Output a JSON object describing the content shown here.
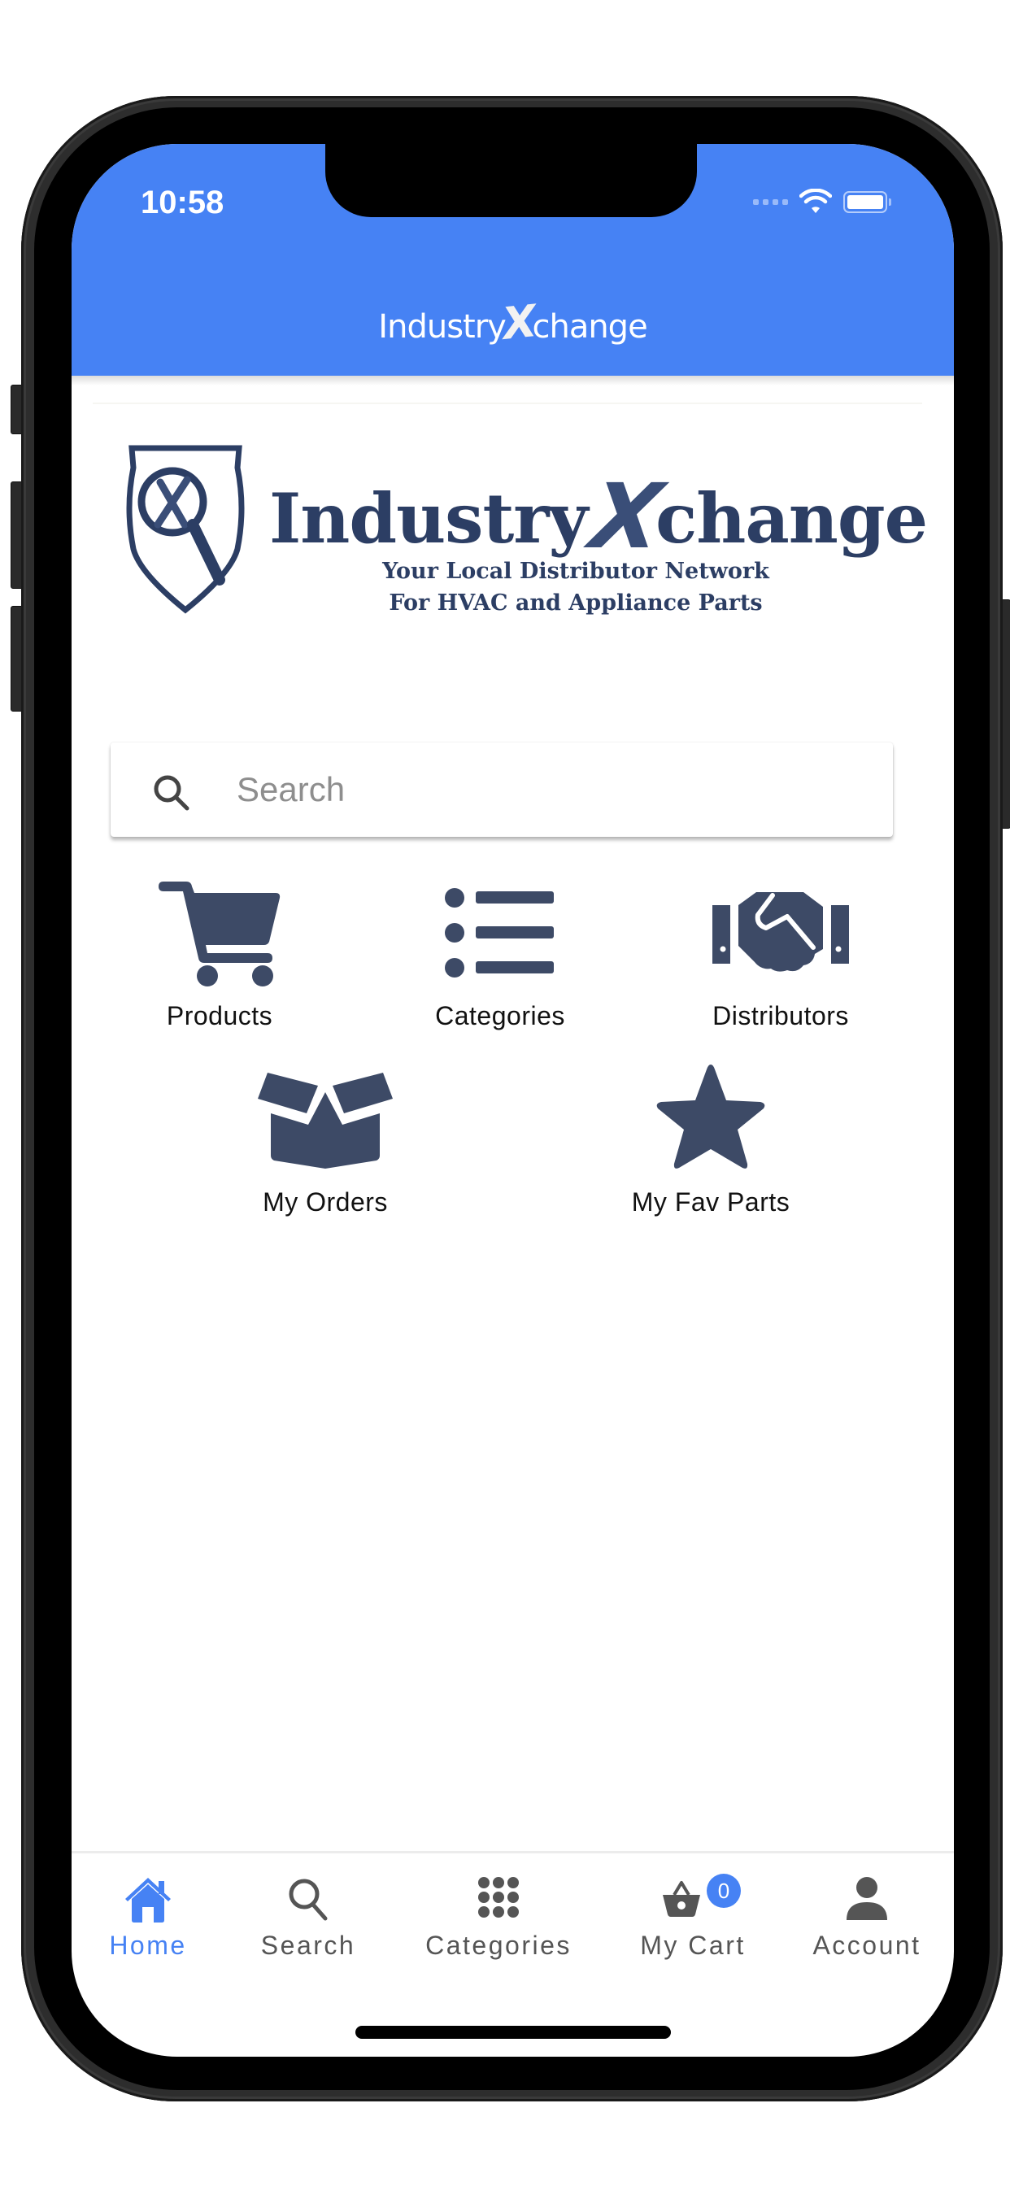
{
  "status_bar": {
    "time": "10:58",
    "wifi_icon": "wifi-icon",
    "battery_icon": "battery-icon",
    "signal_icon": "cellular-signal-icon"
  },
  "header": {
    "title_pre": "Industry",
    "title_x": "X",
    "title_post": "change"
  },
  "logo": {
    "name_pre": "Industry",
    "name_x": "X",
    "name_post": "change",
    "tagline_1": "Your Local Distributor Network",
    "tagline_2": "For HVAC and Appliance Parts",
    "color": "#2c3e64"
  },
  "search": {
    "placeholder": "Search",
    "value": "",
    "icon": "search-icon"
  },
  "tiles": [
    {
      "label": "Products",
      "icon": "shopping-cart-icon"
    },
    {
      "label": "Categories",
      "icon": "list-icon"
    },
    {
      "label": "Distributors",
      "icon": "handshake-icon"
    },
    {
      "label": "My Orders",
      "icon": "open-box-icon"
    },
    {
      "label": "My Fav Parts",
      "icon": "star-icon"
    }
  ],
  "tabbar": {
    "active": "Home",
    "items": [
      {
        "label": "Home",
        "icon": "home-icon"
      },
      {
        "label": "Search",
        "icon": "search-icon"
      },
      {
        "label": "Categories",
        "icon": "grid-icon"
      },
      {
        "label": "My Cart",
        "icon": "basket-icon",
        "badge": "0"
      },
      {
        "label": "Account",
        "icon": "person-icon"
      }
    ]
  },
  "colors": {
    "primary": "#4682f4",
    "icon_navy": "#3d4a66",
    "tab_inactive": "#555555"
  }
}
